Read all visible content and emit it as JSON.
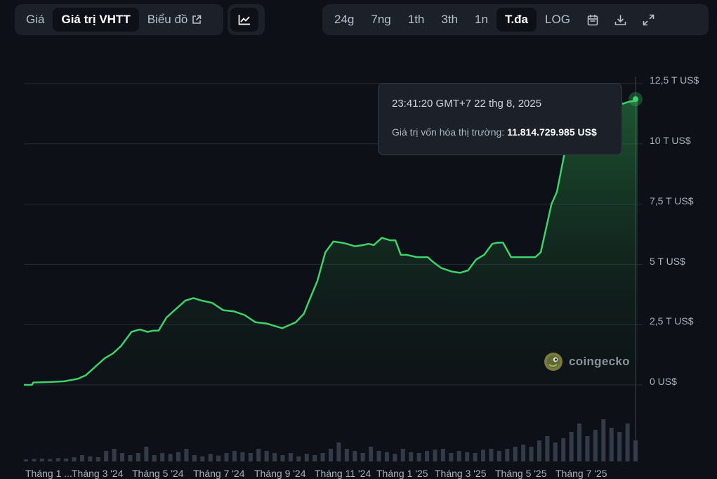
{
  "toolbar": {
    "view_tabs": [
      {
        "label": "Giá",
        "active": false
      },
      {
        "label": "Giá trị VHTT",
        "active": true
      },
      {
        "label": "Biểu đồ",
        "active": false,
        "icon": "external-link-icon"
      }
    ],
    "chart_type_icon": "line-chart-icon",
    "range_tabs": [
      {
        "label": "24g",
        "active": false
      },
      {
        "label": "7ng",
        "active": false
      },
      {
        "label": "1th",
        "active": false
      },
      {
        "label": "3th",
        "active": false
      },
      {
        "label": "1n",
        "active": false
      },
      {
        "label": "T.đa",
        "active": true
      },
      {
        "label": "LOG",
        "active": false
      }
    ],
    "action_icons": [
      "calendar-icon",
      "download-icon",
      "fullscreen-icon"
    ]
  },
  "tooltip": {
    "time": "23:41:20 GMT+7 22 thg 8, 2025",
    "label": "Giá trị vốn hóa thị trường:",
    "value": "11.814.729.985 US$"
  },
  "watermark": {
    "text": "coingecko",
    "icon": "coingecko-logo-icon"
  },
  "colors": {
    "line": "#3fd26a",
    "background": "#0d1117",
    "panel": "#1b2029"
  },
  "chart_data": {
    "type": "area",
    "title": "",
    "xlabel": "",
    "ylabel": "",
    "y_unit": "T US$",
    "ylim": [
      0,
      12.5
    ],
    "grid": true,
    "y_tick_labels": [
      "0 US$",
      "2,5 T US$",
      "5 T US$",
      "7,5 T US$",
      "10 T US$",
      "12,5 T US$"
    ],
    "x_tick_labels": [
      "Tháng 1 ...",
      "Tháng 3 '24",
      "Tháng 5 '24",
      "Tháng 7 '24",
      "Tháng 9 '24",
      "Tháng 11 '24",
      "Tháng 1 '25",
      "Tháng 3 '25",
      "Tháng 5 '25",
      "Tháng 7 '25"
    ],
    "x_months": [
      0,
      0.3,
      0.35,
      1,
      1.5,
      2,
      2.3,
      2.7,
      3,
      3.3,
      3.6,
      4,
      4.3,
      4.6,
      4.8,
      5,
      5.3,
      5.6,
      6,
      6.3,
      6.6,
      7,
      7.4,
      7.8,
      8.2,
      8.6,
      9,
      9.3,
      9.6,
      9.8,
      10.1,
      10.4,
      10.6,
      10.9,
      11.2,
      11.5,
      11.8,
      12,
      12.3,
      12.6,
      12.8,
      13,
      13.3,
      13.6,
      13.8,
      14,
      14.2,
      14.6,
      15,
      15.2,
      15.5,
      15.9,
      16.2,
      16.5,
      16.8,
      17.1,
      17.4,
      17.6,
      17.8,
      18.1,
      18.4,
      18.7,
      19,
      19.2,
      19.4,
      19.6,
      19.8,
      20.1,
      20.4,
      20.7,
      21,
      21.3,
      21.6,
      21.9,
      22.2,
      22.5,
      22.8
    ],
    "values": [
      0,
      0,
      0.1,
      0.12,
      0.15,
      0.25,
      0.4,
      0.8,
      1.1,
      1.3,
      1.6,
      2.2,
      2.3,
      2.2,
      2.25,
      2.25,
      2.8,
      3.1,
      3.5,
      3.6,
      3.5,
      3.4,
      3.1,
      3.05,
      2.9,
      2.6,
      2.55,
      2.45,
      2.35,
      2.45,
      2.6,
      2.95,
      3.5,
      4.3,
      5.5,
      5.95,
      5.9,
      5.85,
      5.75,
      5.8,
      5.85,
      5.8,
      6.1,
      6.0,
      6.0,
      5.4,
      5.4,
      5.3,
      5.3,
      5.1,
      4.85,
      4.7,
      4.65,
      4.75,
      5.2,
      5.4,
      5.85,
      5.9,
      5.9,
      5.3,
      5.3,
      5.3,
      5.3,
      5.5,
      6.5,
      7.5,
      8.0,
      9.7,
      10.0,
      10.5,
      11.0,
      11.3,
      11.5,
      11.6,
      11.65,
      11.75,
      11.8
    ],
    "volume": [
      0.05,
      0.06,
      0.07,
      0.06,
      0.08,
      0.07,
      0.1,
      0.15,
      0.12,
      0.1,
      0.25,
      0.3,
      0.2,
      0.15,
      0.2,
      0.35,
      0.15,
      0.2,
      0.18,
      0.22,
      0.3,
      0.15,
      0.12,
      0.18,
      0.14,
      0.2,
      0.25,
      0.22,
      0.2,
      0.3,
      0.25,
      0.2,
      0.15,
      0.2,
      0.12,
      0.18,
      0.15,
      0.2,
      0.3,
      0.45,
      0.3,
      0.25,
      0.2,
      0.35,
      0.25,
      0.22,
      0.18,
      0.3,
      0.22,
      0.2,
      0.25,
      0.28,
      0.3,
      0.2,
      0.25,
      0.22,
      0.2,
      0.28,
      0.3,
      0.25,
      0.3,
      0.35,
      0.4,
      0.35,
      0.5,
      0.6,
      0.45,
      0.55,
      0.7,
      0.9,
      0.6,
      0.75,
      1.0,
      0.8,
      0.7,
      0.9,
      0.5
    ]
  }
}
